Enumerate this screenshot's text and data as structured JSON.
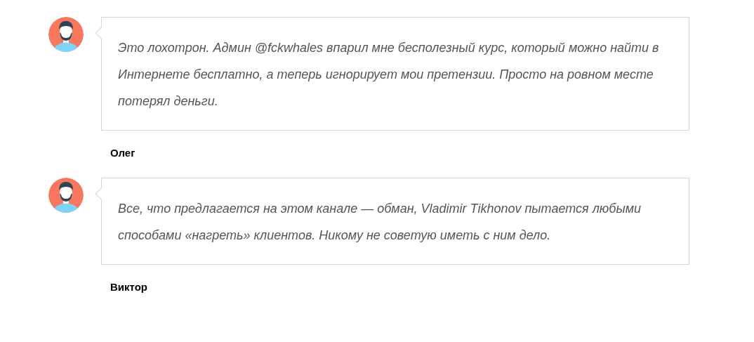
{
  "testimonials": [
    {
      "text": "Это лохотрон. Админ @fckwhales впарил мне бесполезный курс, который можно найти в Интернете бесплатно, а теперь игнорирует мои претензии. Просто на ровном месте потерял деньги.",
      "author": "Олег"
    },
    {
      "text": "Все, что предлагается на этом канале — обман, Vladimir Tikhonov пытается любыми способами «нагреть» клиентов. Никому не советую иметь с ним дело.",
      "author": "Виктор"
    }
  ]
}
